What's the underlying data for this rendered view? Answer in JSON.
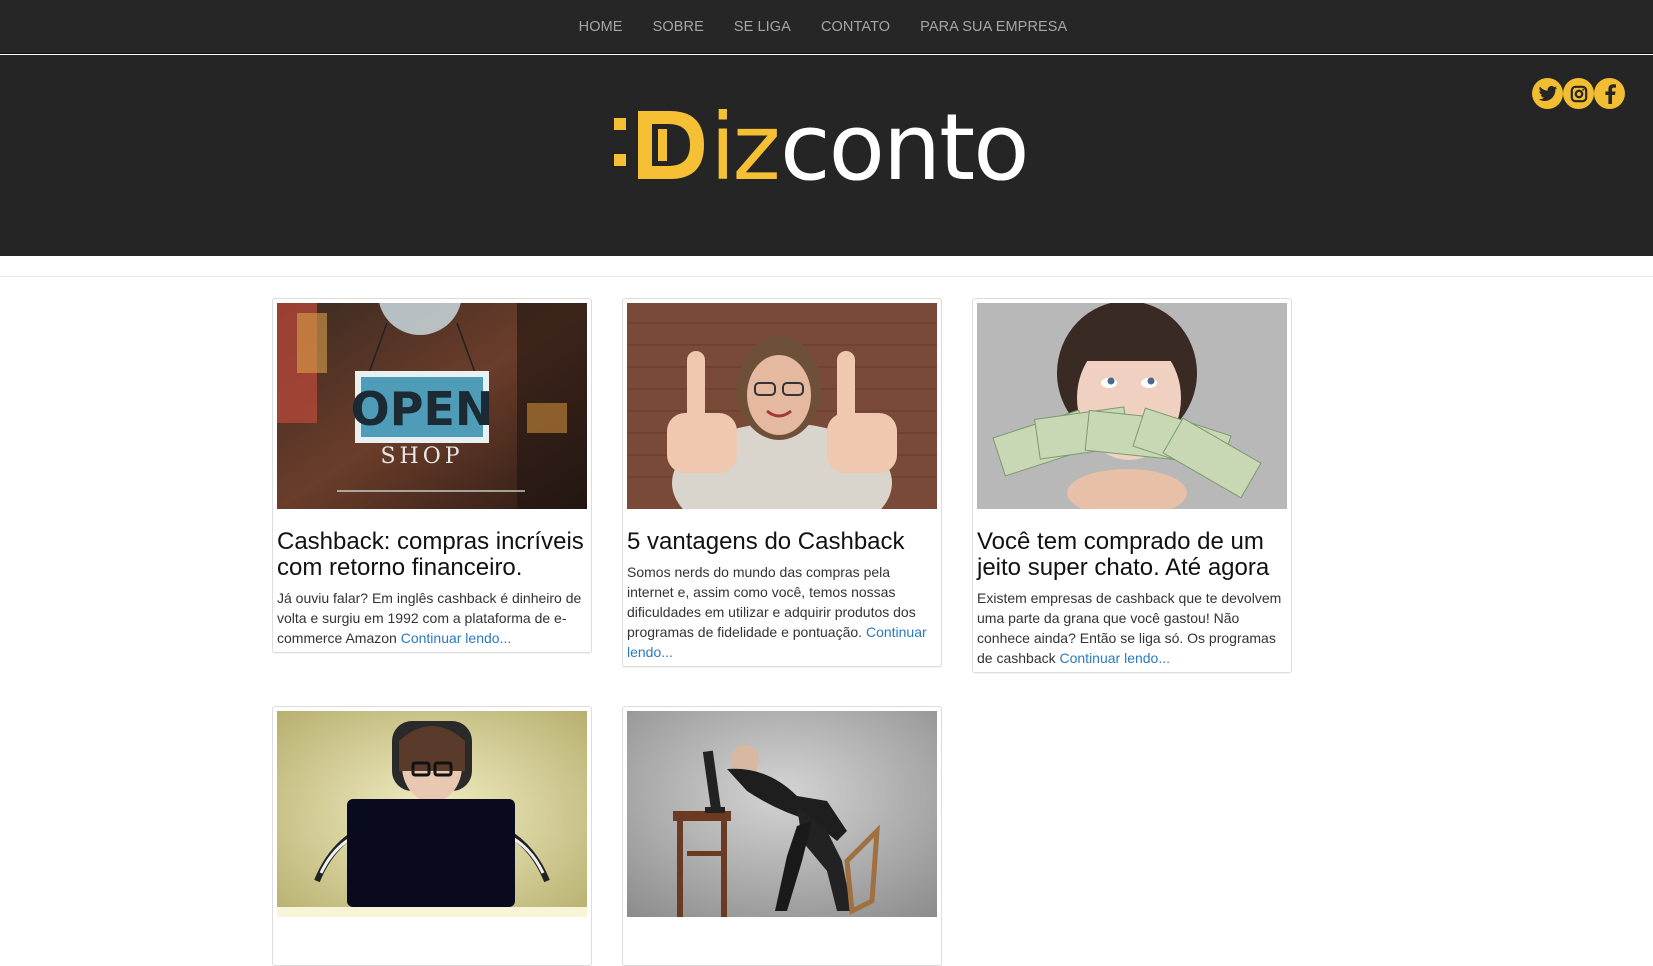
{
  "nav": {
    "items": [
      "HOME",
      "SOBRE",
      "SE LIGA",
      "CONTATO",
      "PARA SUA EMPRESA"
    ]
  },
  "brand": {
    "logo_prefix": "Diz",
    "logo_suffix": "conto",
    "accent_color": "#f5c033",
    "header_bg": "#252525"
  },
  "social": [
    {
      "icon": "twitter-icon"
    },
    {
      "icon": "instagram-icon"
    },
    {
      "icon": "facebook-icon"
    }
  ],
  "posts": [
    {
      "image": "open-shop-sign-photo",
      "image_text_1": "OPEN",
      "image_text_2": "SHOP",
      "title": "Cashback: compras incríveis com retorno financeiro.",
      "excerpt": "Já ouviu falar? Em inglês cashback é dinheiro de volta e surgiu em 1992 com a plataforma de e-commerce Amazon",
      "more": "Continuar lendo..."
    },
    {
      "image": "thumbs-up-woman-photo",
      "title": "5 vantagens do Cashback",
      "excerpt": "Somos nerds do mundo das compras pela internet e, assim como você, temos nossas dificuldades em utilizar e adquirir produtos dos programas de fidelidade e pontuação.",
      "more": "Continuar lendo..."
    },
    {
      "image": "woman-with-money-photo",
      "title": "Você tem comprado de um jeito super chato. Até agora",
      "excerpt": "Existem empresas de cashback que te devolvem uma parte da grana que você gastou! Não conhece ainda? Então se liga só. Os programas de cashback",
      "more": "Continuar lendo..."
    },
    {
      "image": "woman-with-laptop-photo"
    },
    {
      "image": "man-hugging-monitor-photo"
    }
  ]
}
